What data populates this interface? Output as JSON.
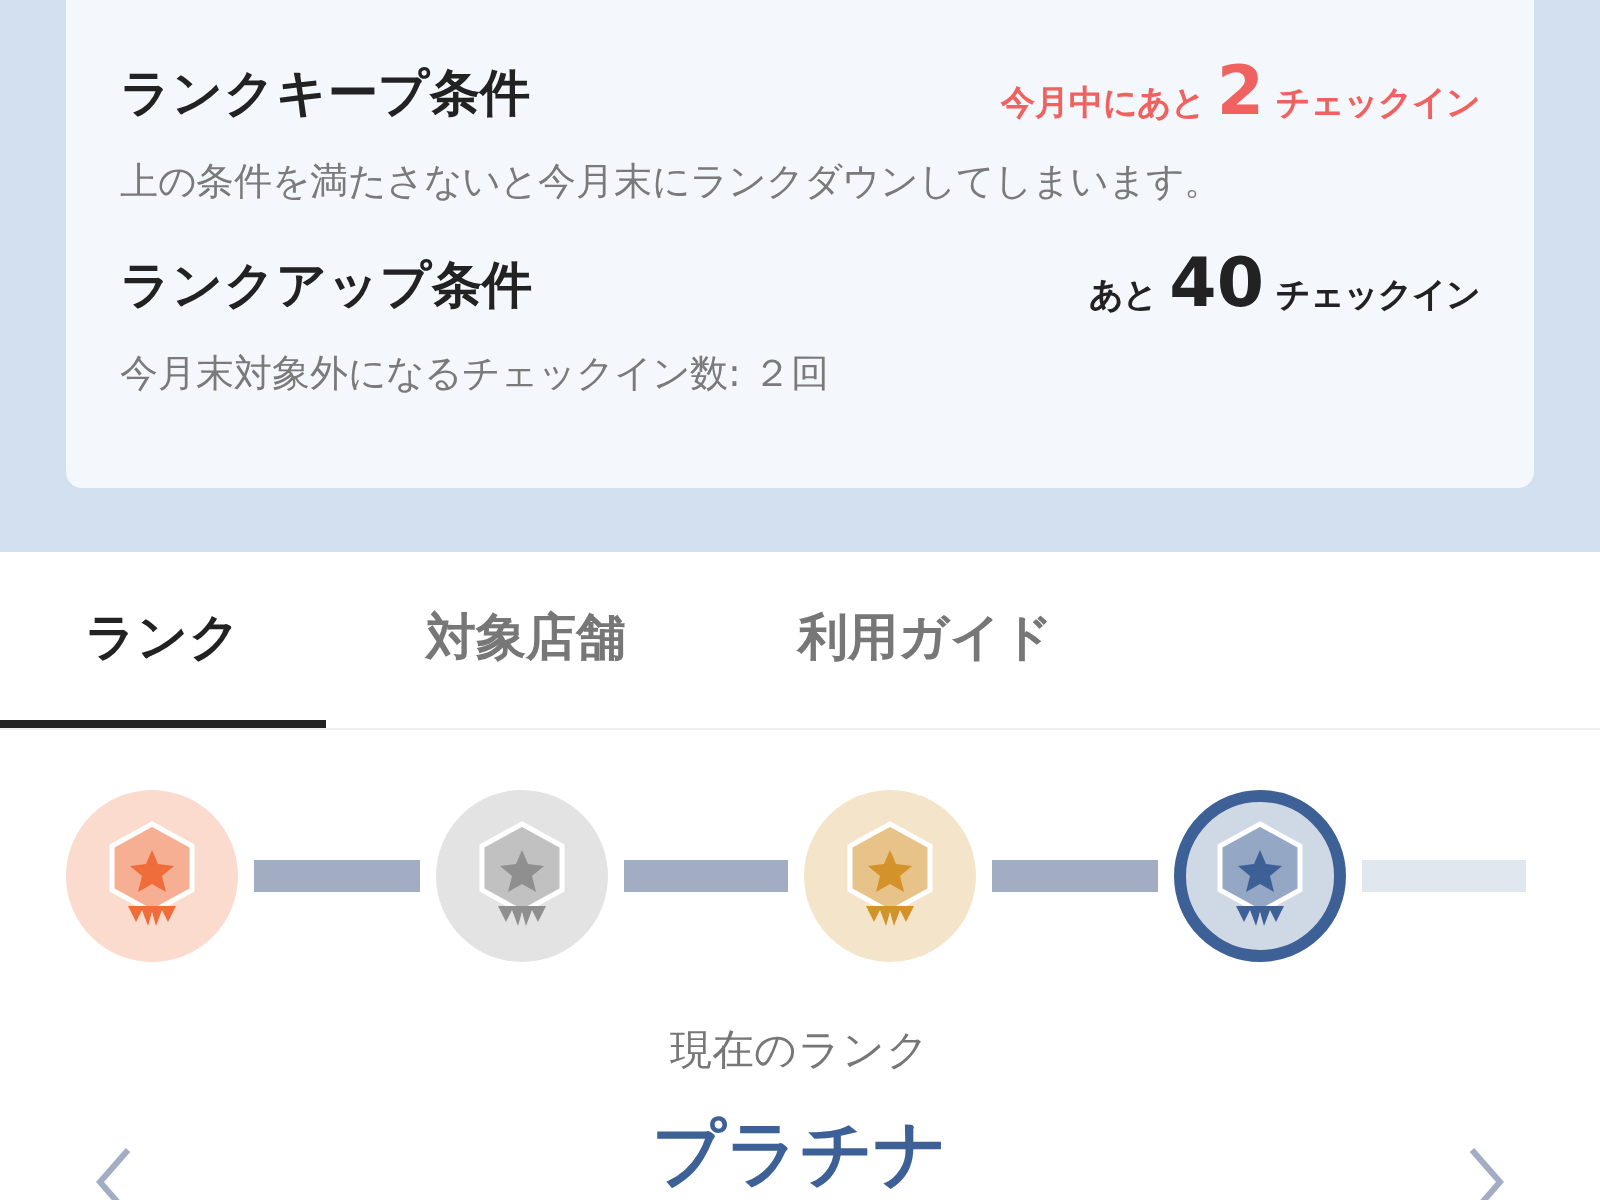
{
  "conditions": [
    {
      "title": "ランクキープ条件",
      "color": "#f0625f",
      "prefix": "今月中にあと",
      "count": "2",
      "suffix": "チェックイン",
      "note": "上の条件を満たさないと今月末にランクダウンしてしまいます。"
    },
    {
      "title": "ランクアップ条件",
      "color": "#222222",
      "prefix": "あと",
      "count": "40",
      "suffix": "チェックイン",
      "note": "今月末対象外になるチェックイン数: ２回"
    }
  ],
  "tabs": [
    {
      "label": "ランク",
      "selected": true
    },
    {
      "label": "対象店舗",
      "selected": false
    },
    {
      "label": "利用ガイド",
      "selected": false
    }
  ],
  "medals": [
    {
      "color": "#ee6d3a",
      "selected": false
    },
    {
      "color": "#8f8f8f",
      "selected": false
    },
    {
      "color": "#d4922a",
      "selected": false
    },
    {
      "color": "#3d6196",
      "selected": true
    }
  ],
  "connectors": [
    {
      "reached": true
    },
    {
      "reached": true
    },
    {
      "reached": true
    },
    {
      "reached": false
    }
  ],
  "current": {
    "label": "現在のランク",
    "rank": "プラチナ"
  }
}
